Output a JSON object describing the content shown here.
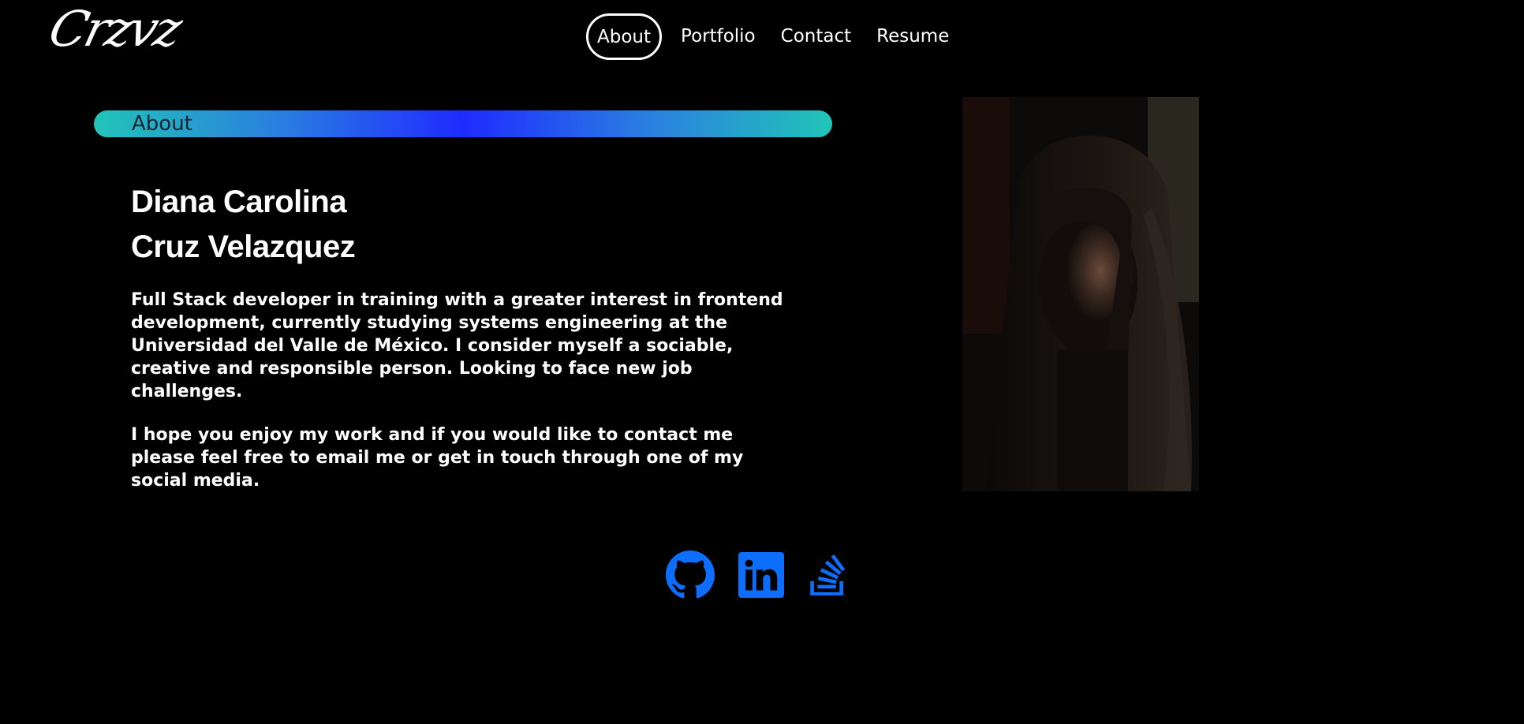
{
  "header": {
    "logo_text": "Crzvz",
    "nav": [
      {
        "label": "About",
        "active": true
      },
      {
        "label": "Portfolio",
        "active": false
      },
      {
        "label": "Contact",
        "active": false
      },
      {
        "label": "Resume",
        "active": false
      }
    ]
  },
  "about": {
    "section_title": "About",
    "name_line1": "Diana Carolina",
    "name_line2": "Cruz Velazquez",
    "paragraph1": "Full Stack developer in training with a greater interest in frontend development, currently studying systems engineering at the Universidad del Valle de México. I consider myself a sociable, creative and responsible person. Looking to face new job challenges.",
    "paragraph2": "I hope you enjoy my work and if you would like to contact me please feel free to email me or get in touch through one of my social media."
  },
  "socials": [
    {
      "icon": "github-icon"
    },
    {
      "icon": "linkedin-icon"
    },
    {
      "icon": "stackoverflow-icon"
    }
  ],
  "colors": {
    "background": "#000000",
    "social_icon": "#0d6efd",
    "gradient_edge": "#22c4b8",
    "gradient_center": "#1f2bff"
  }
}
